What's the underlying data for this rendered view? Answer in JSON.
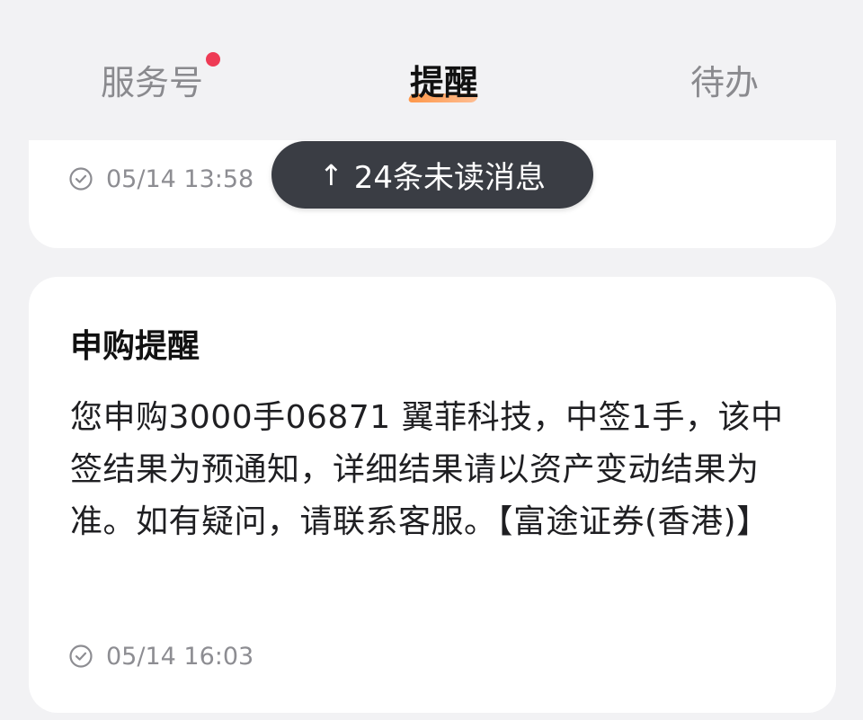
{
  "tabs": {
    "service": "服务号",
    "reminder": "提醒",
    "todo": "待办"
  },
  "unread_banner": {
    "arrow": "↑",
    "text": "24条未读消息"
  },
  "top_card": {
    "timestamp": "05/14 13:58"
  },
  "main_card": {
    "title": "申购提醒",
    "body": "您申购3000手06871 翼菲科技，中签1手，该中签结果为预通知，详细结果请以资产变动结果为准。如有疑问，请联系客服。【富途证券(香港)】",
    "timestamp": "05/14 16:03"
  },
  "colors": {
    "background": "#f2f2f4",
    "badge": "#ee3b55",
    "indicator": "#ff8d36",
    "pill": "#3a3d44"
  }
}
